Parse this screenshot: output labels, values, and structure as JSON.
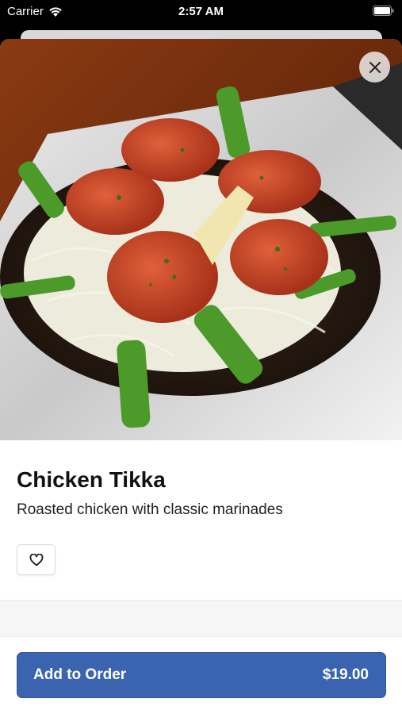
{
  "status_bar": {
    "carrier": "Carrier",
    "time": "2:57 AM"
  },
  "item": {
    "name": "Chicken Tikka",
    "description": "Roasted chicken with classic marinades",
    "image_icon": "food-photo"
  },
  "actions": {
    "close_icon": "close-icon",
    "favorite_icon": "heart-icon",
    "add_to_order_label": "Add to Order",
    "price": "$19.00"
  },
  "colors": {
    "accent": "#3a64b0"
  }
}
